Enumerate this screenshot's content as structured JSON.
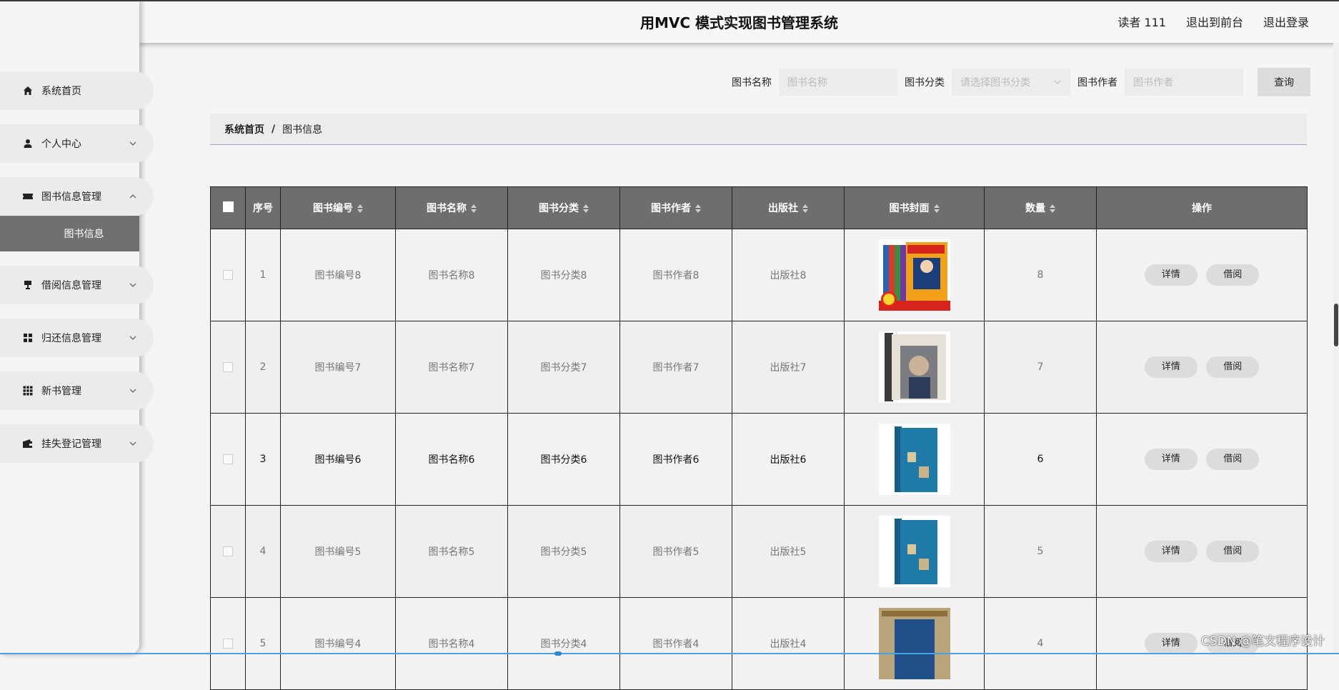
{
  "header": {
    "title": "用MVC 模式实现图书管理系统",
    "user": "读者 111",
    "to_front": "退出到前台",
    "logout": "退出登录"
  },
  "sidebar": {
    "items": [
      {
        "label": "系统首页",
        "icon": "home-icon"
      },
      {
        "label": "个人中心",
        "icon": "user-icon"
      },
      {
        "label": "图书信息管理",
        "icon": "ticket-icon",
        "expanded": true,
        "sub": "图书信息"
      },
      {
        "label": "借阅信息管理",
        "icon": "stand-icon"
      },
      {
        "label": "归还信息管理",
        "icon": "grid-icon"
      },
      {
        "label": "新书管理",
        "icon": "apps-icon"
      },
      {
        "label": "挂失登记管理",
        "icon": "wallet-icon"
      }
    ]
  },
  "search": {
    "name_label": "图书名称",
    "name_placeholder": "图书名称",
    "category_label": "图书分类",
    "category_placeholder": "请选择图书分类",
    "author_label": "图书作者",
    "author_placeholder": "图书作者",
    "query_button": "查询"
  },
  "breadcrumb": {
    "home": "系统首页",
    "separator": "/",
    "current": "图书信息"
  },
  "table": {
    "headers": {
      "index": "序号",
      "code": "图书编号",
      "name": "图书名称",
      "category": "图书分类",
      "author": "图书作者",
      "publisher": "出版社",
      "cover": "图书封面",
      "quantity": "数量",
      "actions": "操作"
    },
    "detail_label": "详情",
    "borrow_label": "借阅",
    "rows": [
      {
        "index": "1",
        "code": "图书编号8",
        "name": "图书名称8",
        "category": "图书分类8",
        "author": "图书作者8",
        "publisher": "出版社8",
        "quantity": "8",
        "cover": "conan-cover"
      },
      {
        "index": "2",
        "code": "图书编号7",
        "name": "图书名称7",
        "category": "图书分类7",
        "author": "图书作者7",
        "publisher": "出版社7",
        "quantity": "7",
        "cover": "vogue-cover"
      },
      {
        "index": "3",
        "code": "图书编号6",
        "name": "图书名称6",
        "category": "图书分类6",
        "author": "图书作者6",
        "publisher": "出版社6",
        "quantity": "6",
        "cover": "blue-book-cover"
      },
      {
        "index": "4",
        "code": "图书编号5",
        "name": "图书名称5",
        "category": "图书分类5",
        "author": "图书作者5",
        "publisher": "出版社5",
        "quantity": "5",
        "cover": "blue-book-cover"
      },
      {
        "index": "5",
        "code": "图书编号4",
        "name": "图书名称4",
        "category": "图书分类4",
        "author": "图书作者4",
        "publisher": "出版社4",
        "quantity": "4",
        "cover": "shelf-cover"
      }
    ]
  },
  "watermark": "CSDN @笔文程序设计",
  "colors": {
    "header_bg": "#6e6e6e",
    "submenu_bg": "#707070",
    "button_bg": "#dcdcdc"
  }
}
